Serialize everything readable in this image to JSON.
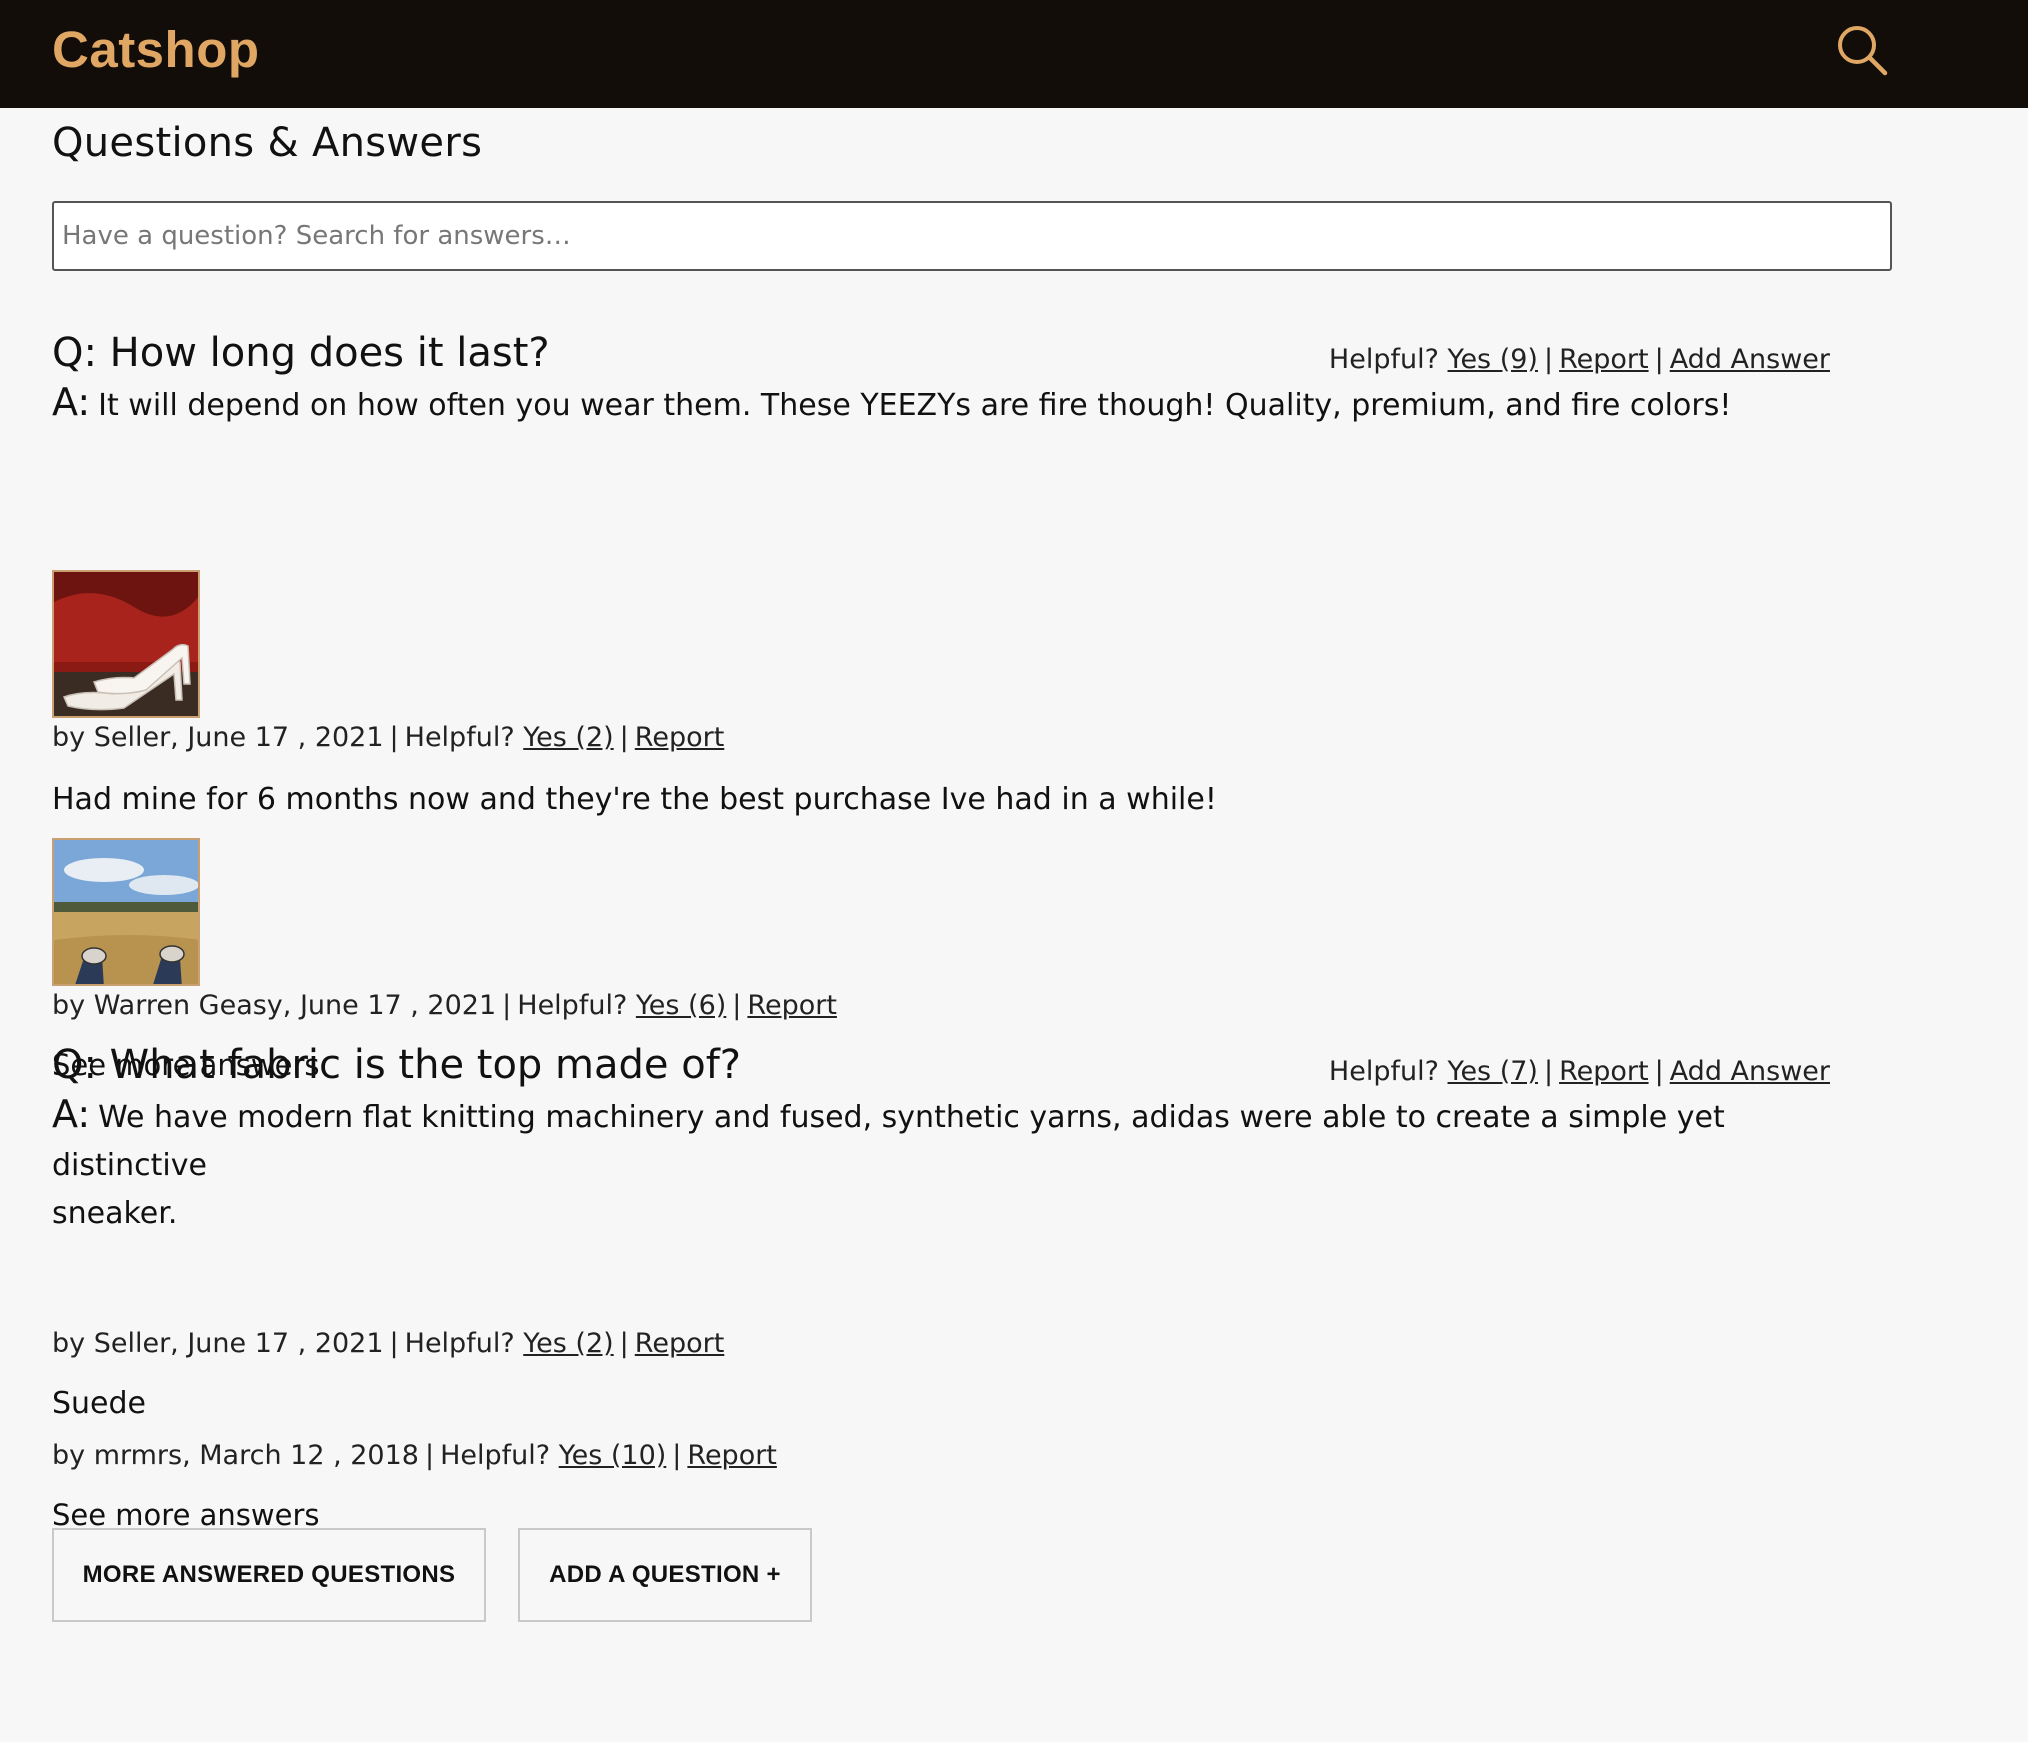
{
  "header": {
    "logo": "Catshop",
    "search_icon": "search-icon",
    "accent_color": "#e0a764",
    "bg_color": "#120d08"
  },
  "main": {
    "title": "Questions & Answers",
    "search_placeholder": "Have a question? Search for answers…"
  },
  "questions": [
    {
      "title": "Q: How long does it last?",
      "helpful_label": "Helpful?",
      "yes_label": "Yes (9)",
      "report_label": "Report",
      "add_answer_label": "Add Answer",
      "answer_prefix": "A:",
      "answers": [
        {
          "text": "It will depend on how often you wear them. These YEEZYs are fire though! Quality, premium, and fire colors!",
          "byline": "by Seller, June 17 , 2021",
          "helpful_label": "Helpful?",
          "yes_label": "Yes (2)",
          "report_label": "Report",
          "photo": "white-heels-photo"
        },
        {
          "text": "Had mine for 6 months now and they're the best purchase Ive had in a while!",
          "byline": "by Warren Geasy, June 17 , 2021",
          "helpful_label": "Helpful?",
          "yes_label": "Yes (6)",
          "report_label": "Report",
          "photo": "field-sneakers-photo"
        }
      ],
      "see_more": "See more answers"
    },
    {
      "title": "Q: What fabric is the top made of?",
      "helpful_label": "Helpful?",
      "yes_label": "Yes (7)",
      "report_label": "Report",
      "add_answer_label": "Add Answer",
      "answer_prefix": "A:",
      "answers": [
        {
          "text_line1": "We have modern flat knitting machinery and fused, synthetic yarns, adidas were able to create a simple yet distinctive",
          "text_line2": "sneaker.",
          "byline": "by Seller, June 17 , 2021",
          "helpful_label": "Helpful?",
          "yes_label": "Yes (2)",
          "report_label": "Report"
        },
        {
          "text": "Suede",
          "byline": "by mrmrs, March 12 , 2018",
          "helpful_label": "Helpful?",
          "yes_label": "Yes (10)",
          "report_label": "Report"
        }
      ],
      "see_more": "See more answers"
    }
  ],
  "buttons": {
    "more_questions": "MORE ANSWERED QUESTIONS",
    "add_question": "ADD A QUESTION +"
  }
}
